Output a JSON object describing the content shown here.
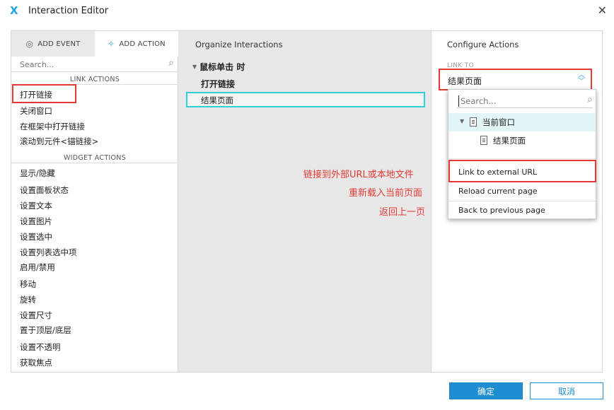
{
  "window": {
    "title": "Interaction Editor",
    "logo": "X",
    "close": "✕"
  },
  "left_panel": {
    "tabs": [
      {
        "label": "ADD EVENT",
        "icon": "event-icon"
      },
      {
        "label": "ADD ACTION",
        "icon": "sparkle-icon"
      }
    ],
    "search_placeholder": "Search...",
    "sections": [
      {
        "heading": "LINK ACTIONS",
        "items": [
          "打开链接",
          "关闭窗口",
          "在框架中打开链接",
          "滚动到元件<锚链接>"
        ]
      },
      {
        "heading": "WIDGET ACTIONS",
        "items": [
          "显示/隐藏",
          "设置面板状态",
          "设置文本",
          "设置图片",
          "设置选中",
          "设置列表选中项",
          "启用/禁用",
          "移动",
          "旋转",
          "设置尺寸",
          "置于顶层/底层",
          "设置不透明",
          "获取焦点"
        ]
      }
    ]
  },
  "middle_panel": {
    "title": "Organize Interactions",
    "event": "鼠标单击 时",
    "action": "打开链接",
    "target": "结果页面"
  },
  "right_panel": {
    "title": "Configure Actions",
    "link_to_label": "LINK TO",
    "selected_value": "结果页面"
  },
  "dropdown": {
    "search_placeholder": "Search...",
    "tree": [
      {
        "label": "当前窗口",
        "level": 0,
        "expanded": true,
        "selected": true
      },
      {
        "label": "结果页面",
        "level": 1,
        "expanded": false,
        "selected": false
      }
    ],
    "options": [
      "Link to external URL",
      "Reload current page",
      "Back to previous page"
    ]
  },
  "annotations": [
    "链接到外部URL或本地文件",
    "重新载入当前页面",
    "返回上一页"
  ],
  "footer": {
    "ok_label": "确定",
    "cancel_label": "取消"
  },
  "colors": {
    "accent": "#1c8ed1",
    "highlight_red": "#e53935",
    "selection_cyan": "#33cfd8"
  }
}
